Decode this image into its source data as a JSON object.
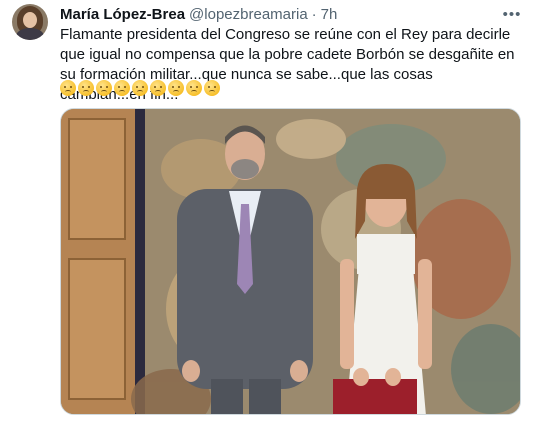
{
  "tweet": {
    "author_name": "María López-Brea",
    "author_handle": "@lopezbreamaria",
    "separator": "·",
    "time": "7h",
    "more_icon": "more-horizontal-icon",
    "text": "Flamante presidenta del Congreso se reúne con el Rey para decirle que igual no compensa que la pobre cadete Borbón se desgañite en su formación militar...que nunca se sabe...que las cosas cambian...en fin...",
    "emoji_count": 9,
    "emoji_icon": "slightly-frowning-face-emoji"
  },
  "colors": {
    "text_primary": "#0f1419",
    "text_secondary": "#536471",
    "border": "#cfd9de"
  }
}
